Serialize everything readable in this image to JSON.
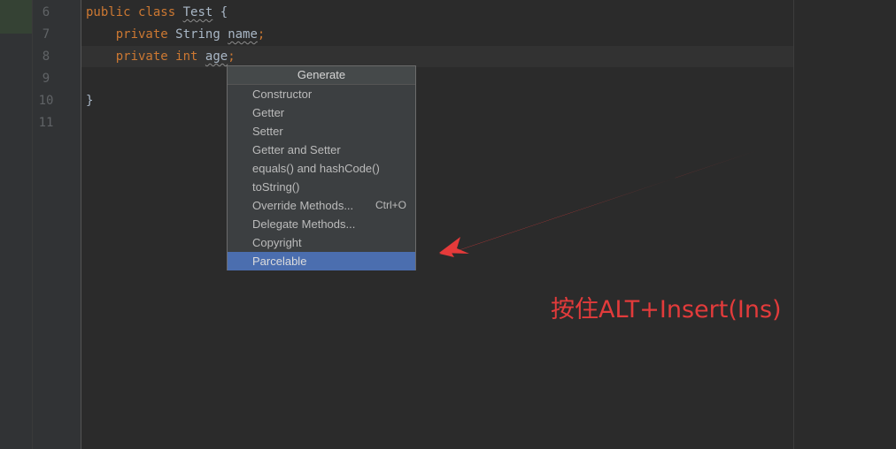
{
  "editor": {
    "line_numbers": [
      "6",
      "7",
      "8",
      "9",
      "10",
      "11"
    ],
    "lines": {
      "l6": {
        "kw1": "public",
        "kw2": "class",
        "name": "Test",
        "brace": "{"
      },
      "l7": {
        "kw": "private",
        "type": "String",
        "name": "name",
        "semi": ";"
      },
      "l8": {
        "kw1": "private",
        "kw2": "int",
        "name": "age",
        "semi": ";"
      },
      "l10": {
        "brace": "}"
      }
    }
  },
  "popup": {
    "title": "Generate",
    "items": [
      {
        "label": "Constructor",
        "shortcut": ""
      },
      {
        "label": "Getter",
        "shortcut": ""
      },
      {
        "label": "Setter",
        "shortcut": ""
      },
      {
        "label": "Getter and Setter",
        "shortcut": ""
      },
      {
        "label": "equals() and hashCode()",
        "shortcut": ""
      },
      {
        "label": "toString()",
        "shortcut": ""
      },
      {
        "label": "Override Methods...",
        "shortcut": "Ctrl+O"
      },
      {
        "label": "Delegate Methods...",
        "shortcut": ""
      },
      {
        "label": "Copyright",
        "shortcut": ""
      },
      {
        "label": "Parcelable",
        "shortcut": ""
      }
    ],
    "selected_item": "Parcelable"
  },
  "annotation": {
    "text": "按住ALT+Insert(Ins)",
    "color": "#e23b3b"
  },
  "colors": {
    "editor_bg": "#2b2b2b",
    "keyword": "#cc7832",
    "identifier": "#a9b7c6",
    "selection": "#4b6eaf"
  },
  "icons": {
    "arrow": "red-arrow-pointing-to-parcelable"
  }
}
